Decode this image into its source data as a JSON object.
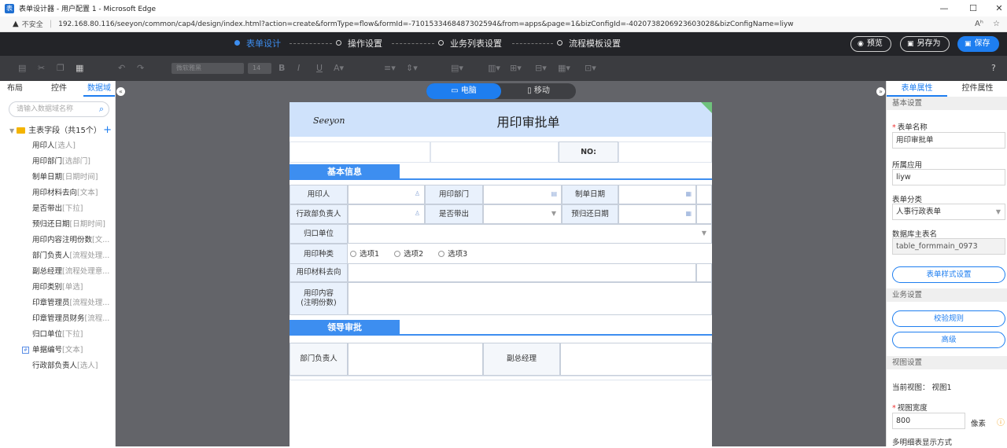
{
  "window": {
    "title": "表单设计器 - 用户配置 1 - Microsoft Edge",
    "minimize": "—",
    "maximize": "☐",
    "close": "✕"
  },
  "address": {
    "warning_icon": "▲",
    "insecure": "不安全",
    "url": "192.168.80.116/seeyon/common/cap4/design/index.html?action=create&formType=flow&formId=-7101533468487302594&from=apps&page=1&bizConfigId=-4020738206923603028&bizConfigName=liyw",
    "read_aloud": "Aʰ",
    "favorite": "☆"
  },
  "steps": [
    {
      "label": "表单设计",
      "active": true
    },
    {
      "label": "操作设置",
      "active": false
    },
    {
      "label": "业务列表设置",
      "active": false
    },
    {
      "label": "流程模板设置",
      "active": false
    }
  ],
  "actions": {
    "preview": "预览",
    "save_as": "另存为",
    "save": "保存"
  },
  "toolbar": {
    "font_family": "微软雅黑",
    "font_size": "14",
    "help": "?"
  },
  "left": {
    "tabs": [
      "布局",
      "控件",
      "数据域"
    ],
    "active_tab": "数据域",
    "search_placeholder": "请输入数据域名称",
    "root_label": "主表字段（共15个）",
    "fields": [
      {
        "name": "用印人",
        "type": "[选人]"
      },
      {
        "name": "用印部门",
        "type": "[选部门]"
      },
      {
        "name": "制单日期",
        "type": "[日期时间]"
      },
      {
        "name": "用印材料去向",
        "type": "[文本]"
      },
      {
        "name": "是否带出",
        "type": "[下拉]"
      },
      {
        "name": "预归还日期",
        "type": "[日期时间]"
      },
      {
        "name": "用印内容注明份数",
        "type": "[文..."
      },
      {
        "name": "部门负责人",
        "type": "[流程处理..."
      },
      {
        "name": "副总经理",
        "type": "[流程处理意..."
      },
      {
        "name": "用印类别",
        "type": "[单选]"
      },
      {
        "name": "印章管理员",
        "type": "[流程处理..."
      },
      {
        "name": "印章管理员财务",
        "type": "[流程..."
      },
      {
        "name": "归口单位",
        "type": "[下拉]"
      },
      {
        "name": "单据编号",
        "type": "[文本]"
      },
      {
        "name": "行政部负责人",
        "type": "[选人]"
      }
    ]
  },
  "canvas": {
    "device_pc": "电脑",
    "device_mobile": "移动",
    "collapse_left": "«",
    "collapse_right": "»"
  },
  "form": {
    "logo": "Seeyon",
    "title": "用印审批单",
    "no_label": "NO:",
    "section_basic": "基本信息",
    "section_leader": "领导审批",
    "labels": {
      "applicant": "用印人",
      "dept": "用印部门",
      "date": "制单日期",
      "admin_head": "行政部负责人",
      "take_out": "是否带出",
      "return_date": "预归还日期",
      "unit": "归口单位",
      "seal_type": "用印种类",
      "destination": "用印材料去向",
      "content_1": "用印内容",
      "content_2": "(注明份数)",
      "dept_head": "部门负责人",
      "vice_gm": "副总经理"
    },
    "options": [
      "选项1",
      "选项2",
      "选项3"
    ]
  },
  "right": {
    "tabs": [
      "表单属性",
      "控件属性"
    ],
    "basic_settings": "基本设置",
    "form_name_label": "表单名称",
    "form_name_value": "用印审批单",
    "app_label": "所属应用",
    "app_value": "liyw",
    "category_label": "表单分类",
    "category_value": "人事行政表单",
    "db_label": "数据库主表名",
    "db_value": "table_formmain_0973",
    "style_btn": "表单样式设置",
    "biz_settings": "业务设置",
    "verify_btn": "校验规则",
    "advanced_btn": "高级",
    "view_settings": "视图设置",
    "current_view_label": "当前视图：",
    "current_view_value": "视图1",
    "width_label": "视图宽度",
    "width_value": "800",
    "width_unit": "像素",
    "multi_label": "多明细表显示方式"
  }
}
